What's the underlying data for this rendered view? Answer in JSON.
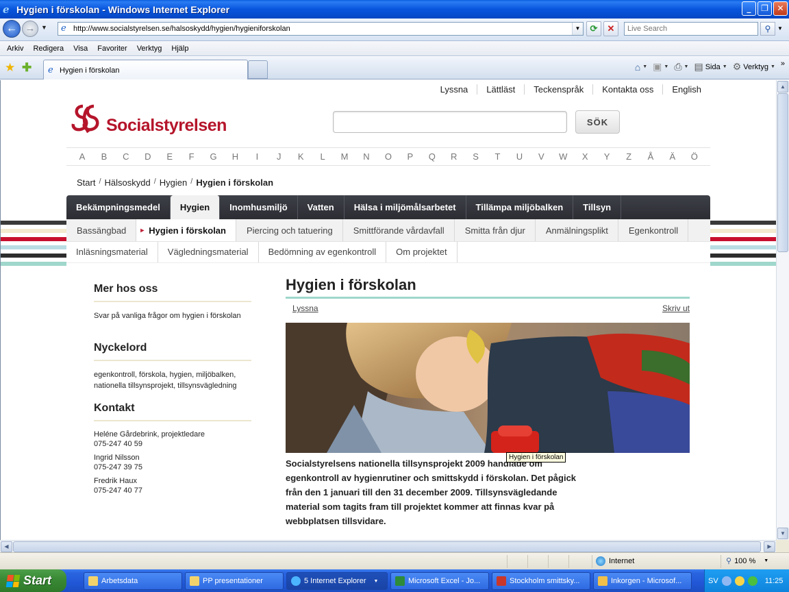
{
  "window": {
    "title": "Hygien i förskolan - Windows Internet Explorer"
  },
  "addressbar": {
    "url": "http://www.socialstyrelsen.se/halsoskydd/hygien/hygieniforskolan",
    "search_placeholder": "Live Search"
  },
  "menubar": [
    "Arkiv",
    "Redigera",
    "Visa",
    "Favoriter",
    "Verktyg",
    "Hjälp"
  ],
  "tab": {
    "label": "Hygien i förskolan"
  },
  "commandbar": {
    "page_label": "Sida",
    "tools_label": "Verktyg"
  },
  "site": {
    "toplinks": [
      "Lyssna",
      "Lättläst",
      "Teckenspråk",
      "Kontakta oss",
      "English"
    ],
    "logo_text": "Socialstyrelsen",
    "search_button": "SÖK",
    "alphabet": [
      "A",
      "B",
      "C",
      "D",
      "E",
      "F",
      "G",
      "H",
      "I",
      "J",
      "K",
      "L",
      "M",
      "N",
      "O",
      "P",
      "Q",
      "R",
      "S",
      "T",
      "U",
      "V",
      "W",
      "X",
      "Y",
      "Z",
      "Å",
      "Ä",
      "Ö"
    ],
    "breadcrumb": [
      "Start",
      "Hälsoskydd",
      "Hygien",
      "Hygien i förskolan"
    ],
    "mainnav": [
      "Bekämpningsmedel",
      "Hygien",
      "Inomhusmiljö",
      "Vatten",
      "Hälsa i miljömålsarbetet",
      "Tillämpa miljöbalken",
      "Tillsyn"
    ],
    "mainnav_active": "Hygien",
    "subnav": [
      "Bassängbad",
      "Hygien i förskolan",
      "Piercing och tatuering",
      "Smittförande vårdavfall",
      "Smitta från djur",
      "Anmälningsplikt",
      "Egenkontroll"
    ],
    "subnav_active": "Hygien i förskolan",
    "subsubnav": [
      "Inläsningsmaterial",
      "Vägledningsmaterial",
      "Bedömning av egenkontroll",
      "Om projektet"
    ],
    "stripe_colors": [
      "#3a3a3a",
      "#f3ead0",
      "#c8102e",
      "#b9dde3",
      "#2d2d2d",
      "#9fd7cc"
    ]
  },
  "sidebar": {
    "more_heading": "Mer hos oss",
    "more_link": "Svar på vanliga frågor om hygien i förskolan",
    "keywords_heading": "Nyckelord",
    "keywords": "egenkontroll, förskola, hygien, miljöbalken, nationella tillsynsprojekt, tillsynsvägledning",
    "contact_heading": "Kontakt",
    "contacts": [
      {
        "name": "Heléne Gårdebrink, projektledare",
        "phone": "075-247 40 59"
      },
      {
        "name": "Ingrid Nilsson",
        "phone": "075-247 39 75"
      },
      {
        "name": "Fredrik Haux",
        "phone": "075-247 40 77"
      }
    ]
  },
  "content": {
    "title": "Hygien i förskolan",
    "listen": "Lyssna",
    "print": "Skriv ut",
    "lead": "Socialstyrelsens nationella tillsynsprojekt 2009 handlade om egenkontroll av hygienrutiner och smittskydd i förskolan. Det pågick från den 1 januari till den 31 december 2009. Tillsynsvägledande material som tagits fram till projektet kommer att finnas kvar på webbplatsen tillsvidare.",
    "image_tooltip": "Hygien i förskolan"
  },
  "statusbar": {
    "zone": "Internet",
    "zoom": "100 %"
  },
  "taskbar": {
    "start": "Start",
    "tasks": [
      "Arbetsdata",
      "PP presentationer",
      "5 Internet Explorer",
      "Microsoft Excel - Jo...",
      "Stockholm smittsky...",
      "Inkorgen - Microsof..."
    ],
    "lang": "SV",
    "clock": "11:25"
  }
}
